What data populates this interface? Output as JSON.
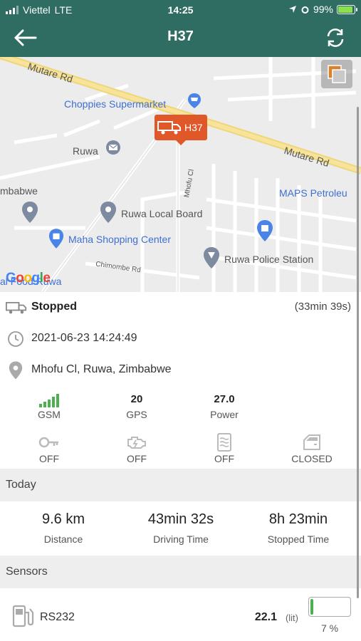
{
  "status_bar": {
    "carrier": "Viettel",
    "network": "LTE",
    "time": "14:25",
    "battery": "99%"
  },
  "header": {
    "title": "H37"
  },
  "map": {
    "marker_label": "H37",
    "labels": {
      "mutare_rd_1": "Mutare Rd",
      "mutare_rd_2": "Mutare Rd",
      "choppies": "Choppies Supermarket",
      "ruwa": "Ruwa",
      "zimbabwe_partial": "mbabwe",
      "mhofu": "Mhofu Cl",
      "maps_petroleum": "MAPS Petroleu",
      "ruwa_local_board": "Ruwa Local Board",
      "maha": "Maha Shopping Center",
      "ruwa_police": "Ruwa Police Station",
      "chimombe": "Chimombe Rd",
      "local_ruwa": "al Food Ruwa",
      "google": "Google"
    }
  },
  "vehicle": {
    "status": "Stopped",
    "duration": "(33min 39s)",
    "datetime": "2021-06-23 14:24:49",
    "address": "Mhofu Cl, Ruwa, Zimbabwe"
  },
  "indicators": [
    {
      "value": "",
      "label": "GSM",
      "level": 5
    },
    {
      "value": "20",
      "label": "GPS"
    },
    {
      "value": "27.0",
      "label": "Power"
    }
  ],
  "states": [
    {
      "icon": "key-icon",
      "label": "OFF"
    },
    {
      "icon": "engine-icon",
      "label": "OFF"
    },
    {
      "icon": "heater-icon",
      "label": "OFF"
    },
    {
      "icon": "door-icon",
      "label": "CLOSED"
    }
  ],
  "today": {
    "title": "Today",
    "stats": [
      {
        "value": "9.6 km",
        "label": "Distance"
      },
      {
        "value": "43min 32s",
        "label": "Driving Time"
      },
      {
        "value": "8h 23min",
        "label": "Stopped Time"
      }
    ]
  },
  "sensors": {
    "title": "Sensors",
    "items": [
      {
        "name": "RS232",
        "value": "22.1",
        "unit": "(lit)",
        "percent_label": "7 %",
        "fill_fraction": 0.07
      }
    ]
  },
  "colors": {
    "header": "#2f6d63",
    "marker": "#e0572a",
    "accent_green": "#4caf50"
  }
}
